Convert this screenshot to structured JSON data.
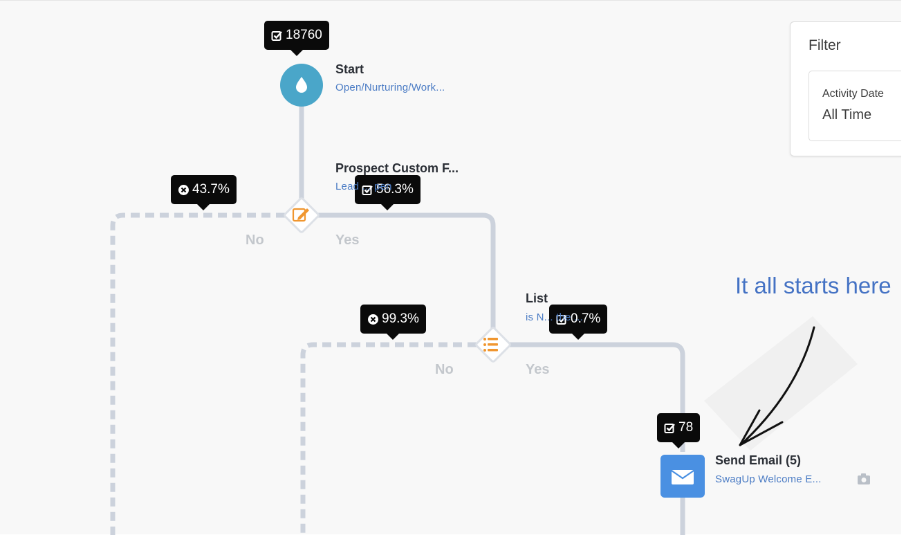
{
  "flow": {
    "start": {
      "count": "18760",
      "title": "Start",
      "subtitle": "Open/Nurturing/Work..."
    },
    "rule1": {
      "title": "Prospect Custom F...",
      "subtitle": "Lead ... pen",
      "no_pct": "43.7%",
      "yes_pct": "56.3%",
      "no_label": "No",
      "yes_label": "Yes"
    },
    "rule2": {
      "title": "List",
      "subtitle": "is N...  the ...",
      "no_pct": "99.3%",
      "yes_pct": "0.7%",
      "no_label": "No",
      "yes_label": "Yes"
    },
    "email": {
      "count": "78",
      "title": "Send Email (5)",
      "subtitle": "SwagUp Welcome E..."
    }
  },
  "filter": {
    "title": "Filter",
    "field_label": "Activity Date",
    "field_value": "All Time"
  },
  "annotation": {
    "text": "It all starts here"
  },
  "colors": {
    "start_node": "#4aa6c9",
    "rule_icon": "#f0962f",
    "email_node": "#4a90e2",
    "connector": "#ccd2dc",
    "annotation": "#4472c4"
  }
}
